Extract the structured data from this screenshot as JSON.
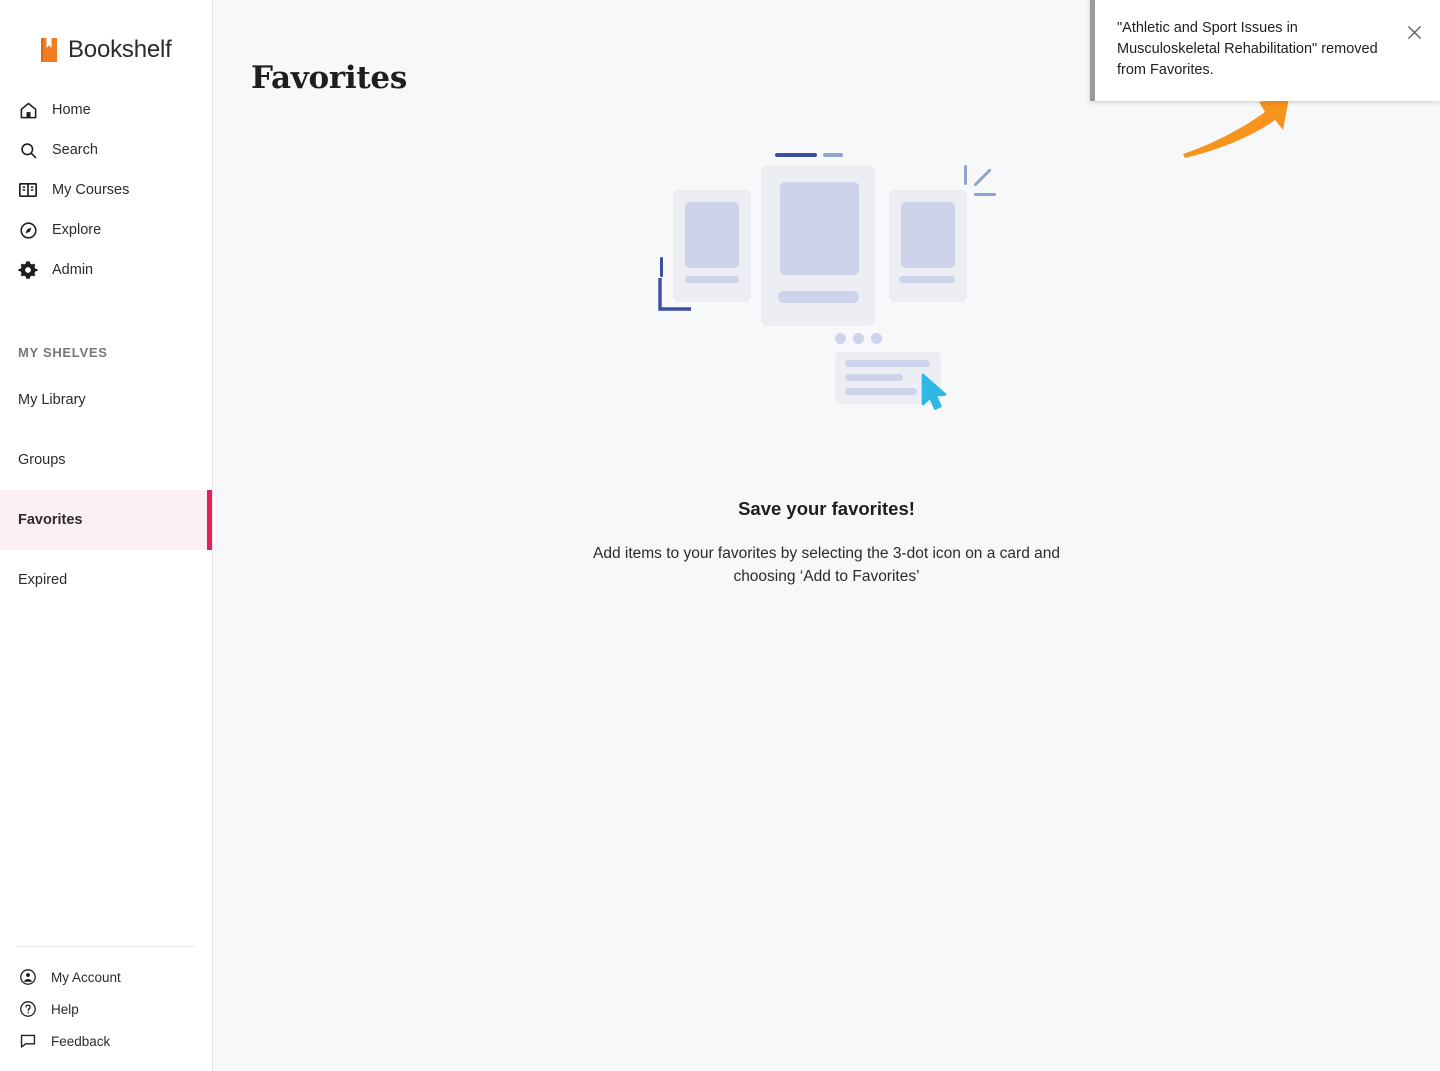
{
  "brand": {
    "name": "Bookshelf",
    "icon": "book-bookmark-icon",
    "color": "#f07d22"
  },
  "sidebar": {
    "nav_items": [
      {
        "label": "Home",
        "icon": "home-icon"
      },
      {
        "label": "Search",
        "icon": "search-icon"
      },
      {
        "label": "My Courses",
        "icon": "open-book-icon"
      },
      {
        "label": "Explore",
        "icon": "compass-icon"
      },
      {
        "label": "Admin",
        "icon": "gear-icon"
      }
    ],
    "shelves_heading": "MY SHELVES",
    "shelves": [
      {
        "label": "My Library",
        "active": false
      },
      {
        "label": "Groups",
        "active": false
      },
      {
        "label": "Favorites",
        "active": true
      },
      {
        "label": "Expired",
        "active": false
      }
    ],
    "active_accent": "#e0235a",
    "active_bg": "#fdf0f4",
    "footer_items": [
      {
        "label": "My Account",
        "icon": "account-circle-icon"
      },
      {
        "label": "Help",
        "icon": "question-circle-icon"
      },
      {
        "label": "Feedback",
        "icon": "speech-bubble-icon"
      }
    ]
  },
  "main": {
    "page_title": "Favorites",
    "empty_state": {
      "illustration": "book-cards-with-menu-illustration",
      "heading": "Save your favorites!",
      "body": "Add items to your favorites by selecting the 3-dot icon on a card and choosing ‘Add to Favorites’"
    }
  },
  "toast": {
    "message": "\"Athletic and Sport Issues in Musculoskeletal Rehabilitation\" removed from Favorites.",
    "close_icon": "close-icon",
    "accent_color": "#9b9b9b"
  },
  "annotation": {
    "arrow": "orange-arrow-pointing-to-toast",
    "color": "#f7941e"
  }
}
